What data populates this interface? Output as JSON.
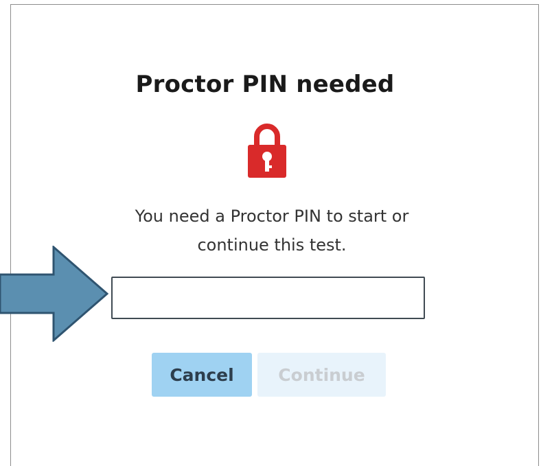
{
  "dialog": {
    "title": "Proctor PIN needed",
    "lock_icon": "padlock-with-key-icon",
    "message_line1": "You need a Proctor PIN to start or",
    "message_line2": "continue this test.",
    "pin_input": {
      "value": "",
      "placeholder": ""
    },
    "buttons": {
      "cancel_label": "Cancel",
      "continue_label": "Continue",
      "continue_enabled": false
    }
  },
  "annotation": {
    "icon": "right-arrow-icon",
    "points_to": "pin-input"
  },
  "colors": {
    "lock_red": "#d92a2a",
    "cancel_bg": "#9fd2f2",
    "continue_bg": "#e8f3fb",
    "arrow_fill": "#5b8fb0",
    "arrow_stroke": "#2f5470"
  }
}
